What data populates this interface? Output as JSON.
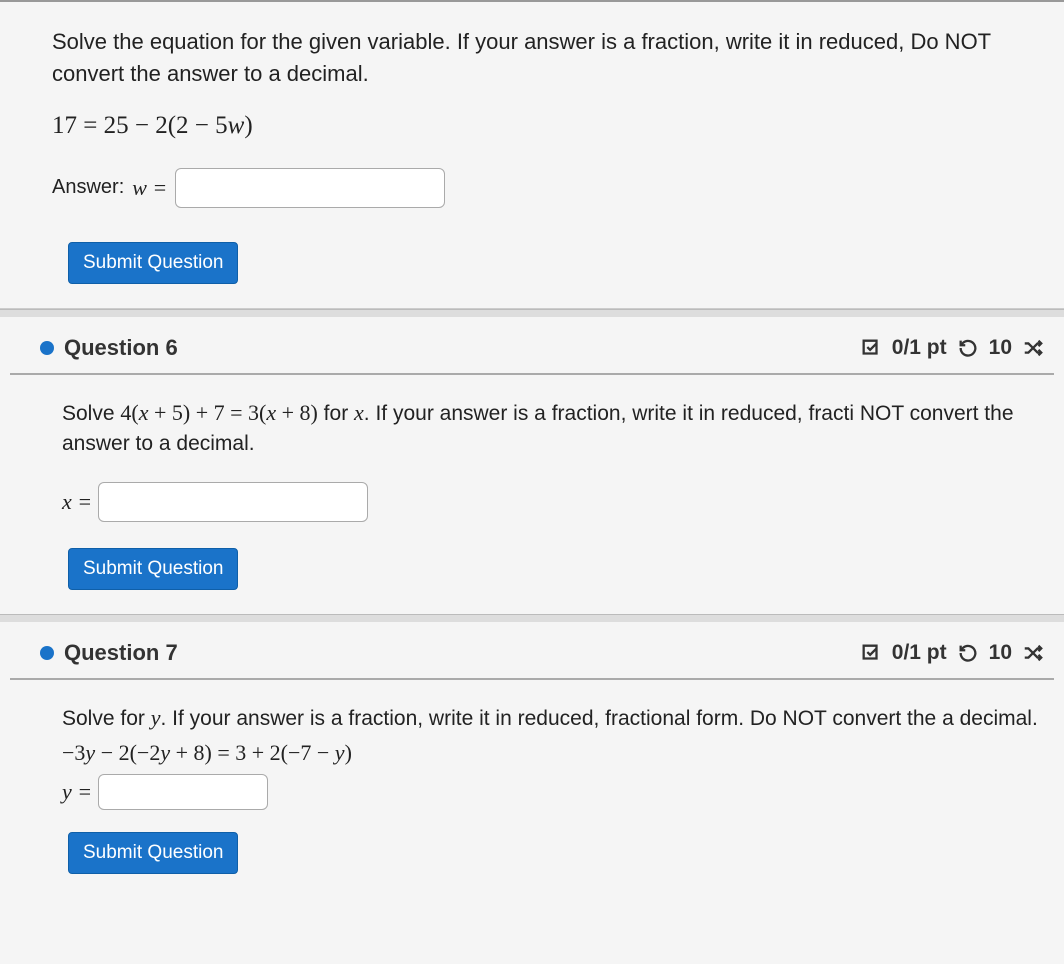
{
  "q5": {
    "prompt": "Solve the equation for the given variable. If your answer is a fraction, write it in reduced, Do NOT convert the answer to a decimal.",
    "equation": "17 = 25 − 2(2 − 5w)",
    "answer_label": "Answer:",
    "var_label": "w =",
    "submit": "Submit Question"
  },
  "q6": {
    "header": "Question 6",
    "points": "0/1 pt",
    "attempts": "10",
    "prompt_pre": "Solve ",
    "equation_inline": "4(x + 5) + 7 = 3(x + 8)",
    "prompt_mid": " for ",
    "prompt_var": "x",
    "prompt_post": ". If your answer is a fraction, write it in reduced, fracti NOT convert the answer to a decimal.",
    "var_label": "x =",
    "submit": "Submit Question"
  },
  "q7": {
    "header": "Question 7",
    "points": "0/1 pt",
    "attempts": "10",
    "prompt": "Solve for y. If your answer is a fraction, write it in reduced, fractional form. Do NOT convert the a decimal.",
    "equation": "−3y − 2(−2y + 8) = 3 + 2(−7 − y)",
    "var_label": "y =",
    "submit": "Submit Question"
  }
}
